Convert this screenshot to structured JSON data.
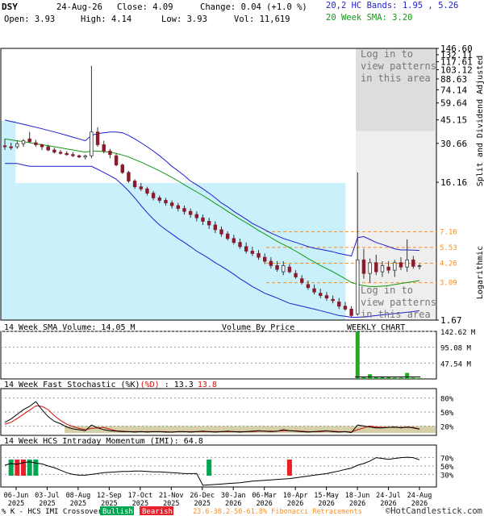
{
  "header": {
    "symbol": "DSY",
    "date": "24-Aug-26",
    "close": "Close: 4.09",
    "change": "Change: 0.04 (+1.0 %)",
    "open": "Open: 3.93",
    "high": "High: 4.14",
    "low": "Low: 3.93",
    "vol": "Vol: 11,619",
    "bands": "20,2 HC Bands: 1.95 , 5.26",
    "sma": "20 Week SMA: 3.20"
  },
  "colors": {
    "bullish": "#00a651",
    "bearish": "#e8202a",
    "candle": "#8b1a2b",
    "band": "#1f1fd0",
    "sma": "#119911",
    "shade": "#c9f0fb",
    "fib": "#ff8c1a",
    "volume": "#22aa22"
  },
  "side_labels": {
    "right_title": "Split and Dividend Adjusted",
    "log": "Logarithmic",
    "pattern_msg_top": [
      "Log in to",
      "view patterns",
      "in this area"
    ],
    "pattern_msg_bottom": [
      "Log in to",
      "view patterns",
      "in this area"
    ],
    "volume_by_price": "Volume By Price",
    "weekly": "WEEKLY CHART"
  },
  "chart_data": [
    {
      "type": "candlestick",
      "name": "price",
      "scale": "log",
      "ylim": [
        1.67,
        146.6
      ],
      "y_ticks": [
        "146.60",
        "132.11",
        "117.61",
        "103.12",
        "88.63",
        "74.14",
        "59.64",
        "45.15",
        "30.66",
        "16.16",
        "1.67"
      ],
      "fib_levels": [
        7.16,
        5.53,
        4.26,
        3.09
      ],
      "x_labels": [
        "06-Jun 2025",
        "03-Jul 2025",
        "08-Aug 2025",
        "12-Sep 2025",
        "17-Oct 2025",
        "21-Nov 2025",
        "26-Dec 2025",
        "30-Jan 2026",
        "06-Mar 2026",
        "10-Apr 2026",
        "15-May 2026",
        "18-Jun 2026",
        "24-Jul 2026",
        "24-Aug 2026"
      ],
      "ohlc": [
        [
          29.5,
          33,
          27.5,
          29
        ],
        [
          29,
          31,
          27.5,
          28.5
        ],
        [
          29,
          32,
          28,
          30.5
        ],
        [
          30.5,
          33,
          29,
          32
        ],
        [
          33,
          37,
          31,
          31.5
        ],
        [
          31,
          32.5,
          29,
          30
        ],
        [
          30,
          30.5,
          27.5,
          29
        ],
        [
          29,
          30,
          27,
          27.5
        ],
        [
          27.5,
          28.5,
          26,
          26.5
        ],
        [
          26.5,
          27.5,
          25.5,
          26
        ],
        [
          26,
          27,
          25,
          25.5
        ],
        [
          25.5,
          26.5,
          24.5,
          25
        ],
        [
          25,
          25.5,
          24,
          24.5
        ],
        [
          24.5,
          25.5,
          23.5,
          25
        ],
        [
          25,
          110,
          24,
          37
        ],
        [
          37,
          40,
          29,
          30
        ],
        [
          30,
          32,
          26,
          27
        ],
        [
          27,
          28,
          24,
          25.5
        ],
        [
          25,
          26,
          21,
          21.5
        ],
        [
          21.5,
          22,
          18.5,
          19
        ],
        [
          19,
          19.5,
          16,
          16.5
        ],
        [
          16.5,
          17,
          14.5,
          15
        ],
        [
          15,
          16,
          14,
          14.5
        ],
        [
          14.5,
          15,
          13,
          13.5
        ],
        [
          13.5,
          14,
          12,
          12.5
        ],
        [
          12.5,
          13,
          11.5,
          12
        ],
        [
          12,
          12.5,
          11,
          11.5
        ],
        [
          11.5,
          12,
          10.5,
          11
        ],
        [
          11,
          11.5,
          10,
          10.5
        ],
        [
          10.5,
          11,
          9.5,
          10
        ],
        [
          10,
          10.5,
          9,
          9.5
        ],
        [
          9.5,
          10,
          8.5,
          9
        ],
        [
          9,
          9.5,
          8,
          8.5
        ],
        [
          8.5,
          9,
          7.5,
          8
        ],
        [
          8,
          8.5,
          7,
          7.4
        ],
        [
          7.4,
          7.8,
          6.6,
          6.9
        ],
        [
          6.9,
          7.2,
          6.2,
          6.4
        ],
        [
          6.4,
          6.8,
          5.8,
          6.0
        ],
        [
          6.0,
          6.4,
          5.4,
          5.6
        ],
        [
          5.6,
          6.0,
          5.0,
          5.2
        ],
        [
          5.2,
          5.6,
          4.8,
          5.0
        ],
        [
          5.0,
          5.3,
          4.5,
          4.7
        ],
        [
          4.7,
          5.0,
          4.2,
          4.4
        ],
        [
          4.4,
          4.7,
          3.9,
          4.1
        ],
        [
          4.1,
          4.4,
          3.7,
          3.85
        ],
        [
          3.7,
          4.4,
          3.5,
          4.1
        ],
        [
          4.0,
          4.2,
          3.6,
          3.7
        ],
        [
          3.6,
          3.8,
          3.3,
          3.4
        ],
        [
          3.3,
          3.5,
          3.0,
          3.1
        ],
        [
          3.0,
          3.2,
          2.75,
          2.85
        ],
        [
          2.8,
          3.0,
          2.55,
          2.65
        ],
        [
          2.6,
          2.8,
          2.4,
          2.5
        ],
        [
          2.5,
          2.65,
          2.3,
          2.4
        ],
        [
          2.35,
          2.5,
          2.2,
          2.3
        ],
        [
          2.25,
          2.4,
          2.0,
          2.1
        ],
        [
          2.1,
          2.25,
          1.95,
          2.0
        ],
        [
          2.0,
          2.1,
          1.75,
          1.8
        ],
        [
          1.85,
          19,
          1.8,
          4.5
        ],
        [
          4.5,
          5.4,
          3.3,
          3.6
        ],
        [
          3.6,
          4.6,
          3.1,
          4.3
        ],
        [
          4.3,
          4.9,
          3.5,
          3.7
        ],
        [
          3.7,
          4.4,
          3.4,
          4.1
        ],
        [
          4.0,
          4.4,
          3.6,
          3.8
        ],
        [
          3.8,
          4.5,
          3.4,
          4.3
        ],
        [
          4.3,
          4.7,
          3.8,
          4.0
        ],
        [
          4.0,
          6.3,
          3.7,
          4.5
        ],
        [
          4.5,
          4.8,
          3.9,
          4.05
        ],
        [
          4.05,
          4.2,
          3.85,
          4.09
        ]
      ],
      "bands_upper": [
        45,
        44,
        43,
        42,
        41,
        40,
        39,
        38,
        37,
        36,
        35,
        34,
        33,
        32,
        35,
        36,
        36.5,
        37,
        37,
        36.5,
        35,
        33,
        31,
        29,
        27,
        25,
        23,
        21,
        19.5,
        18,
        16.5,
        15.5,
        14.5,
        13.5,
        12.5,
        11.5,
        10.8,
        10,
        9.4,
        8.8,
        8.2,
        7.8,
        7.4,
        7.0,
        6.7,
        6.4,
        6.2,
        6.0,
        5.8,
        5.6,
        5.45,
        5.35,
        5.25,
        5.15,
        5.0,
        4.9,
        4.8,
        6.5,
        6.6,
        6.3,
        6.0,
        5.8,
        5.6,
        5.4,
        5.3,
        5.3,
        5.28,
        5.26
      ],
      "bands_lower": [
        22,
        22,
        22,
        21.5,
        21,
        21,
        21,
        21,
        21,
        21,
        21,
        21,
        21,
        21,
        21,
        20,
        19,
        18,
        17,
        15.5,
        14,
        12.5,
        11,
        9.8,
        8.8,
        8,
        7.4,
        6.9,
        6.4,
        6.0,
        5.6,
        5.2,
        4.9,
        4.6,
        4.3,
        4.05,
        3.8,
        3.55,
        3.3,
        3.1,
        2.9,
        2.75,
        2.6,
        2.5,
        2.4,
        2.3,
        2.2,
        2.15,
        2.1,
        2.05,
        2.0,
        1.95,
        1.9,
        1.85,
        1.8,
        1.78,
        1.75,
        1.75,
        1.76,
        1.78,
        1.8,
        1.82,
        1.84,
        1.86,
        1.88,
        1.9,
        1.92,
        1.95
      ],
      "sma": [
        33,
        32.5,
        32,
        31.5,
        31,
        30.5,
        30,
        29.5,
        29,
        28.5,
        28,
        27.5,
        27,
        26.5,
        27,
        27,
        26.8,
        26.5,
        26,
        25.3,
        24.5,
        23.5,
        22.5,
        21.5,
        20.5,
        19.5,
        18.5,
        17.5,
        16.5,
        15.5,
        14.6,
        13.8,
        13,
        12.2,
        11.4,
        10.7,
        10,
        9.4,
        8.8,
        8.3,
        7.8,
        7.3,
        6.9,
        6.5,
        6.1,
        5.8,
        5.5,
        5.2,
        4.9,
        4.6,
        4.35,
        4.1,
        3.9,
        3.7,
        3.5,
        3.3,
        3.1,
        3.0,
        2.95,
        2.9,
        2.9,
        2.92,
        2.95,
        3.0,
        3.05,
        3.1,
        3.15,
        3.2
      ]
    },
    {
      "type": "bar",
      "name": "volume",
      "title": "14 Week SMA Volume: 14.05 M",
      "y_ticks": [
        "142.62 M",
        "95.08 M",
        "47.54 M"
      ],
      "ylim": [
        0,
        142.62
      ],
      "values": [
        0,
        0,
        0,
        0,
        0,
        0,
        0,
        0,
        0,
        0,
        0,
        0,
        0,
        0,
        0,
        0,
        0,
        0,
        0,
        0,
        0,
        0,
        0,
        0,
        0,
        0,
        0,
        0,
        0,
        0,
        0,
        0,
        0,
        0,
        0,
        0,
        0,
        0,
        0,
        0,
        0,
        0,
        0,
        0,
        0,
        0,
        0,
        0,
        0,
        0,
        0,
        0,
        0,
        0,
        0,
        0,
        0,
        142,
        5,
        14,
        6,
        5,
        5,
        4,
        4,
        18,
        4,
        3
      ]
    },
    {
      "type": "line",
      "name": "stochastic",
      "title_prefix": "14 Week Fast Stochastic (%K)",
      "title_d": "(%D)",
      "title_sep": " : ",
      "k_value": "13.3",
      "d_value": "13.8",
      "y_ticks": [
        "80%",
        "50%",
        "20%"
      ],
      "ylim": [
        0,
        100
      ],
      "k": [
        28,
        35,
        45,
        55,
        62,
        72,
        55,
        40,
        30,
        25,
        18,
        14,
        12,
        10,
        22,
        16,
        12,
        10,
        9,
        8,
        8,
        7,
        8,
        7,
        8,
        8,
        7,
        7,
        8,
        8,
        7,
        8,
        9,
        8,
        7,
        8,
        9,
        8,
        7,
        8,
        9,
        10,
        9,
        8,
        9,
        12,
        10,
        9,
        8,
        7,
        8,
        9,
        10,
        8,
        7,
        8,
        6,
        22,
        20,
        18,
        16,
        16,
        17,
        18,
        16,
        18,
        16,
        13.3
      ],
      "d": [
        24,
        28,
        36,
        45,
        54,
        63,
        62,
        55,
        42,
        32,
        24,
        19,
        15,
        12,
        15,
        16,
        17,
        13,
        10,
        9,
        8,
        8,
        8,
        8,
        8,
        8,
        8,
        7,
        8,
        8,
        8,
        8,
        8,
        8,
        8,
        8,
        8,
        8,
        8,
        8,
        8,
        9,
        9,
        9,
        9,
        10,
        10,
        10,
        9,
        8,
        8,
        8,
        9,
        9,
        8,
        8,
        7,
        12,
        16,
        20,
        18,
        17,
        17,
        17,
        17,
        17,
        17,
        13.8
      ]
    },
    {
      "type": "line",
      "name": "momentum",
      "title": "14 Week HCS Intraday Momentum (IMI): 64.8",
      "y_ticks": [
        "70%",
        "50%",
        "30%"
      ],
      "ylim": [
        0,
        100
      ],
      "values": [
        52,
        56,
        54,
        58,
        60,
        57,
        55,
        50,
        46,
        40,
        34,
        30,
        28,
        28,
        30,
        32,
        34,
        35,
        36,
        37,
        37,
        38,
        38,
        37,
        36,
        36,
        35,
        34,
        33,
        32,
        32,
        32,
        4,
        5,
        6,
        7,
        8,
        9,
        10,
        12,
        14,
        15,
        16,
        17,
        18,
        19,
        20,
        22,
        24,
        26,
        28,
        30,
        32,
        35,
        38,
        42,
        45,
        52,
        56,
        62,
        70,
        68,
        66,
        68,
        70,
        71,
        70,
        64.8
      ],
      "bull_markers": [
        1,
        4,
        5,
        33
      ],
      "bear_markers": [
        2,
        3,
        46
      ]
    }
  ],
  "footer": {
    "prefix": "% K - HCS IMI Crossover:",
    "bullish": "Bullish",
    "bearish": "Bearish",
    "fib": "23.6-38.2-50-61.8% Fibonacci Retracements",
    "watermark": "©HotCandlestick.com"
  }
}
